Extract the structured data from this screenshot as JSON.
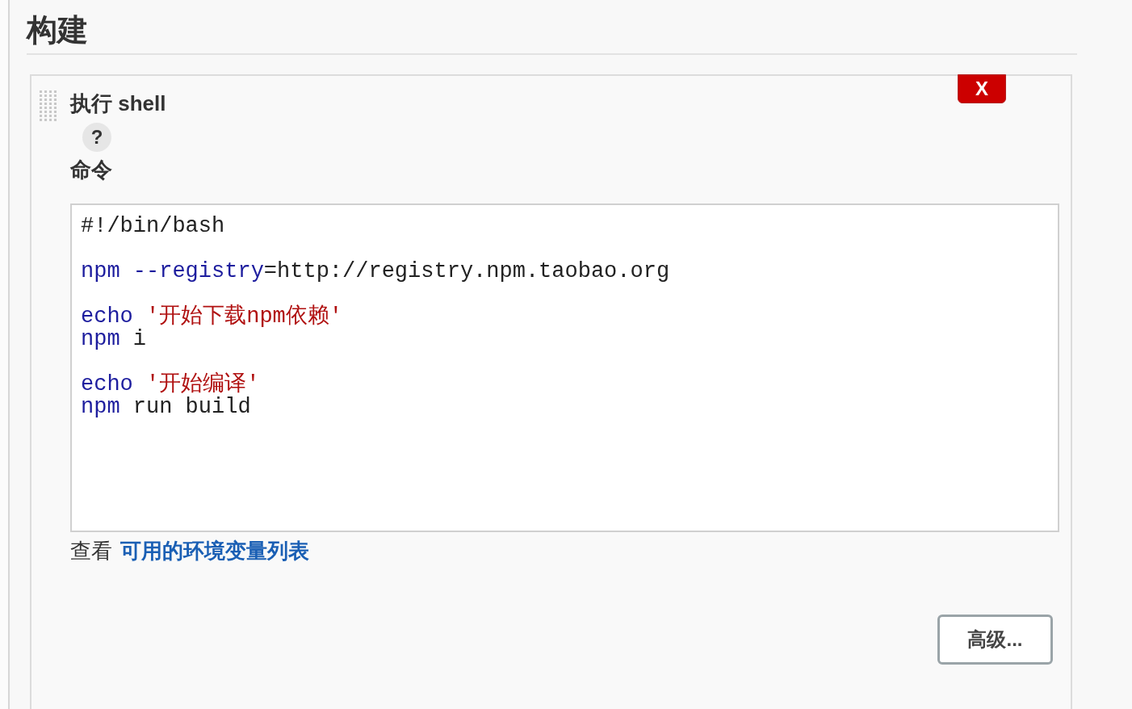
{
  "section": {
    "title": "构建"
  },
  "step": {
    "title": "执行 shell",
    "delete_label": "X",
    "help": "?",
    "field_label": "命令",
    "code_blocks": [
      [
        [
          {
            "kind": "plain",
            "text": "#!/bin/bash"
          }
        ]
      ],
      [
        [
          {
            "kind": "keyword",
            "text": "npm --registry"
          },
          {
            "kind": "plain",
            "text": "=http://registry.npm.taobao.org"
          }
        ]
      ],
      [
        [
          {
            "kind": "keyword",
            "text": "echo "
          },
          {
            "kind": "string",
            "text": "'开始下载npm依赖'"
          }
        ],
        [
          {
            "kind": "keyword",
            "text": "npm"
          },
          {
            "kind": "plain",
            "text": " i"
          }
        ]
      ],
      [
        [
          {
            "kind": "keyword",
            "text": "echo "
          },
          {
            "kind": "string",
            "text": "'开始编译'"
          }
        ],
        [
          {
            "kind": "keyword",
            "text": "npm"
          },
          {
            "kind": "plain",
            "text": " run build"
          }
        ]
      ]
    ],
    "env_prefix": "查看",
    "env_link": "可用的环境变量列表",
    "advanced_button": "高级..."
  }
}
